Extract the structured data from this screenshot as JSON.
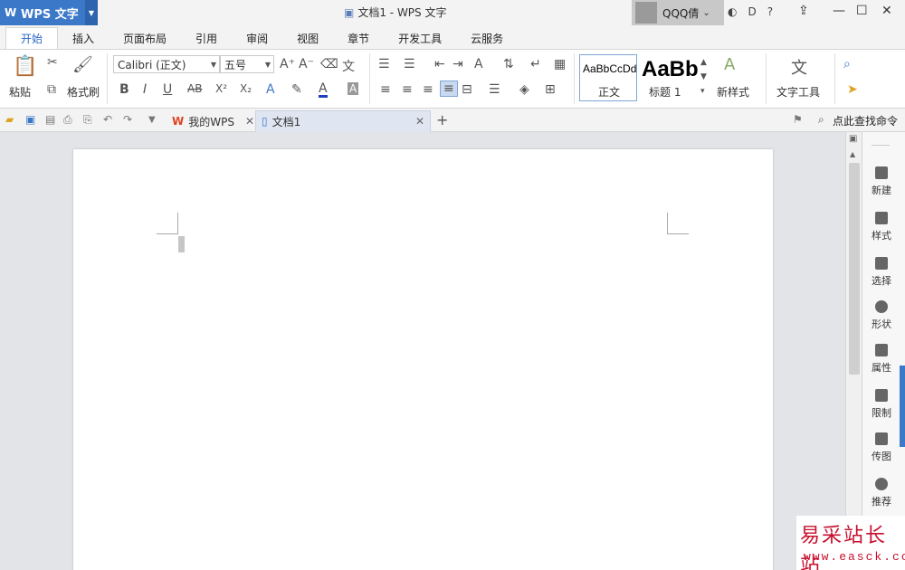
{
  "app": {
    "name": "WPS 文字",
    "logo": "W"
  },
  "window": {
    "title": "文档1 - WPS 文字"
  },
  "user": {
    "name": "QQQ倩"
  },
  "menu_tabs": [
    "开始",
    "插入",
    "页面布局",
    "引用",
    "审阅",
    "视图",
    "章节",
    "开发工具",
    "云服务"
  ],
  "ribbon": {
    "paste": "粘贴",
    "format_painter": "格式刷",
    "font_name": "Calibri (正文)",
    "font_size": "五号",
    "style_normal_preview": "AaBbCcDd",
    "style_normal_label": "正文",
    "style_heading_preview": "AaBb",
    "style_heading_label": "标题 1",
    "new_style": "新样式",
    "text_tools": "文字工具",
    "bold": "B",
    "italic": "I",
    "underline": "U",
    "strike": "AB",
    "superscript": "X²",
    "subscript": "X₂"
  },
  "doc_tabs": [
    {
      "label": "我的WPS"
    },
    {
      "label": "文档1"
    }
  ],
  "search_cmd": "点此查找命令",
  "right_panel": [
    "新建",
    "样式",
    "选择",
    "形状",
    "属性",
    "限制",
    "传图",
    "推荐"
  ],
  "watermark": {
    "text": "易采站长站",
    "url": "www.easck.com"
  },
  "colors": {
    "accent": "#3c78c8",
    "watermark": "#c8102e"
  }
}
